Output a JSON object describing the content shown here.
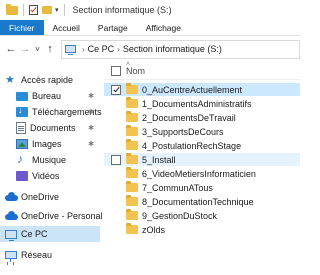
{
  "window": {
    "title": "Section informatique (S:)"
  },
  "ribbon": {
    "tabs": [
      "Fichier",
      "Accueil",
      "Partage",
      "Affichage"
    ]
  },
  "address": {
    "crumbs": [
      "Ce PC",
      "Section informatique (S:)"
    ]
  },
  "sidebar": {
    "items": [
      {
        "label": "Accès rapide",
        "icon": "star-icon",
        "pinned": false
      },
      {
        "label": "Bureau",
        "icon": "desktop-icon",
        "pinned": true
      },
      {
        "label": "Téléchargements",
        "icon": "download-icon",
        "pinned": true
      },
      {
        "label": "Documents",
        "icon": "document-icon",
        "pinned": true
      },
      {
        "label": "Images",
        "icon": "image-icon",
        "pinned": true
      },
      {
        "label": "Musique",
        "icon": "music-icon",
        "pinned": false
      },
      {
        "label": "Vidéos",
        "icon": "video-icon",
        "pinned": false
      },
      {
        "label": "OneDrive",
        "icon": "cloud-icon",
        "pinned": false
      },
      {
        "label": "OneDrive - Personal",
        "icon": "cloud-icon",
        "pinned": false
      },
      {
        "label": "Ce PC",
        "icon": "computer-icon",
        "pinned": false,
        "selected": true
      },
      {
        "label": "Réseau",
        "icon": "network-icon",
        "pinned": false
      }
    ]
  },
  "content": {
    "column_name": "Nom",
    "rows": [
      {
        "name": "0_AuCentreActuellement",
        "checked": true,
        "state": "selected"
      },
      {
        "name": "1_DocumentsAdministratifs",
        "checked": false,
        "state": ""
      },
      {
        "name": "2_DocumentsDeTravail",
        "checked": false,
        "state": ""
      },
      {
        "name": "3_SupportsDeCours",
        "checked": false,
        "state": ""
      },
      {
        "name": "4_PostulationRechStage",
        "checked": false,
        "state": ""
      },
      {
        "name": "5_Install",
        "checked": false,
        "state": "hover",
        "show_checkbox": true
      },
      {
        "name": "6_VideoMetiersInformaticien",
        "checked": false,
        "state": ""
      },
      {
        "name": "7_CommunATous",
        "checked": false,
        "state": ""
      },
      {
        "name": "8_DocumentationTechnique",
        "checked": false,
        "state": ""
      },
      {
        "name": "9_GestionDuStock",
        "checked": false,
        "state": ""
      },
      {
        "name": "zOlds",
        "checked": false,
        "state": ""
      }
    ]
  },
  "colors": {
    "accent": "#1979ca",
    "selection": "#cce8ff",
    "hover": "#e5f3ff",
    "folder": "#f2c350"
  }
}
